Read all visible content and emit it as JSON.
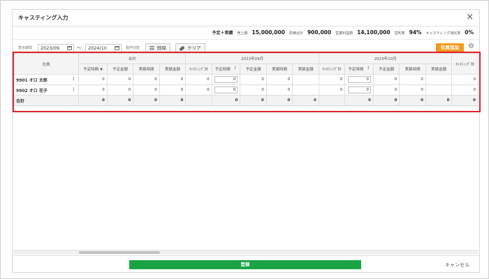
{
  "dialog": {
    "title": "キャスティング入力",
    "close_symbol": "×"
  },
  "summary": {
    "mode": "予定＋実績",
    "sales_label": "売上額",
    "sales_value": "15,000,000",
    "cost_label": "原価合計",
    "cost_value": "900,000",
    "profit_label": "営業利益額",
    "profit_value": "14,100,000",
    "profit_rate_label": "営利率",
    "profit_rate_value": "94%",
    "casting_rate_label": "キャスティング消化率",
    "casting_rate_value": "0%"
  },
  "toolbar": {
    "period_label": "表示期間",
    "start_date": "2023/09",
    "tilde": "～",
    "end_date": "2024/10",
    "op_label": "操作切替",
    "delete_label": "削除",
    "clear_label": "クリア",
    "add_employee_label": "社員追加",
    "gear_symbol": "⚙"
  },
  "table": {
    "employee_header": "社員",
    "group_headers": [
      "合計",
      "2023年09月",
      "2023年10月"
    ],
    "total_subheaders": [
      "予定時間",
      "予定金額",
      "実績時間",
      "実績金額"
    ],
    "month_subheaders": [
      "ｷｬｽﾃｨﾝｸﾞ計",
      "予定時間",
      "予定金額",
      "実績時間",
      "実績金額"
    ],
    "trailing_subheader": "ｷｬｽﾃｨﾝｸﾞ計",
    "rows": [
      {
        "employee": "9901 オロ 太郎",
        "total": [
          "0",
          "0",
          "0",
          "0"
        ],
        "m1": [
          "0",
          "0",
          "0",
          "0",
          ""
        ],
        "m2": [
          "0",
          "0",
          "0",
          "0",
          ""
        ],
        "trailing": "0"
      },
      {
        "employee": "9902 オロ 花子",
        "total": [
          "0",
          "0",
          "0",
          "0"
        ],
        "m1": [
          "0",
          "0",
          "0",
          "0",
          ""
        ],
        "m2": [
          "0",
          "0",
          "0",
          "0",
          ""
        ],
        "trailing": "0"
      }
    ],
    "total_row": {
      "label": "合計",
      "total": [
        "0",
        "0",
        "0",
        "0"
      ],
      "m1": [
        "",
        "0",
        "0",
        "0",
        "0"
      ],
      "m2": [
        "",
        "0",
        "0",
        "0",
        "0"
      ],
      "trailing": "0"
    }
  },
  "footer": {
    "register_label": "登録",
    "cancel_label": "キャンセル"
  }
}
